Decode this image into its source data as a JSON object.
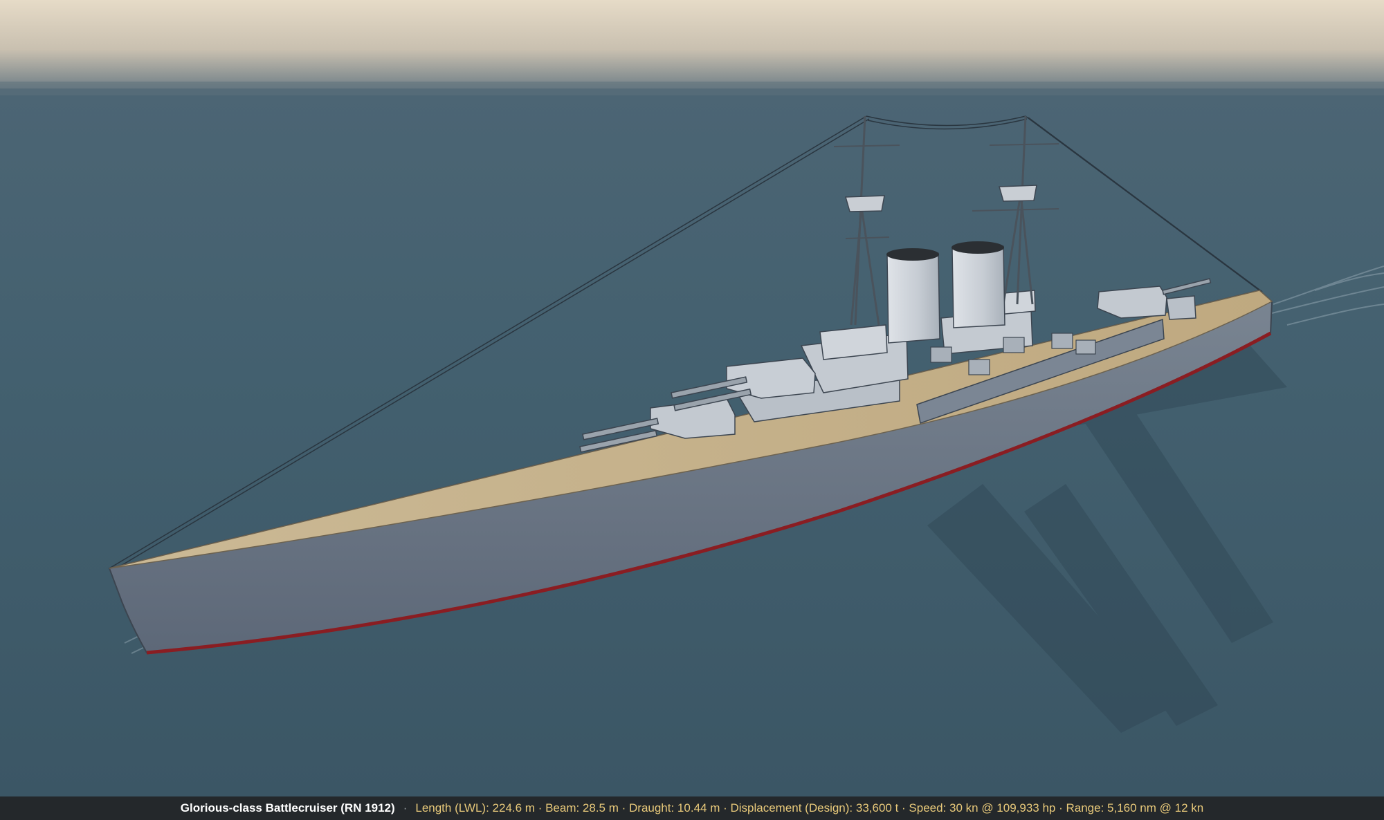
{
  "caption": {
    "ship_name": "Glorious-class Battlecruiser (RN 1912)",
    "separator": "·",
    "specs": "Length (LWL): 224.6 m · Beam: 28.5 m · Draught: 10.44 m · Displacement (Design): 33,600 t · Speed: 30 kn @ 109,933 hp · Range: 5,160 nm @ 12 kn"
  },
  "colors": {
    "sky_top": "#e5dac6",
    "horizon": "#4b6473",
    "sea": "#3f5a68",
    "hull": "#6c7886",
    "deck": "#c9b48e",
    "superstructure": "#c9ced4",
    "boot_topping": "#8a1d22",
    "caption_bg": "#24282b",
    "caption_text": "#e8c97a"
  }
}
